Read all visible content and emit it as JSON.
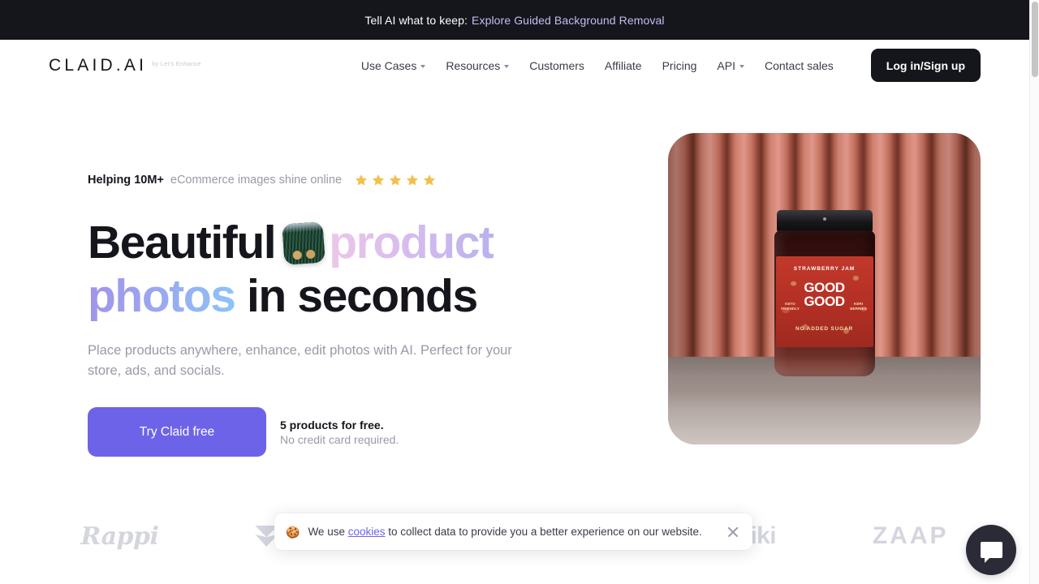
{
  "announcement": {
    "text": "Tell AI what to keep:",
    "link_label": "Explore Guided Background Removal"
  },
  "header": {
    "logo": {
      "main": "CLAID.AI",
      "sub": "by Let's Enhance"
    },
    "nav": [
      {
        "label": "Use Cases",
        "caret": true
      },
      {
        "label": "Resources",
        "caret": true
      },
      {
        "label": "Customers",
        "caret": false
      },
      {
        "label": "Affiliate",
        "caret": false
      },
      {
        "label": "Pricing",
        "caret": false
      },
      {
        "label": "API",
        "caret": true
      },
      {
        "label": "Contact sales",
        "caret": false
      }
    ],
    "login_label": "Log in/Sign up"
  },
  "hero": {
    "eyebrow_strong": "Helping 10M+",
    "eyebrow_light": "eCommerce images shine online",
    "star_count": 5,
    "star_color": "#f2c14b",
    "title_line1_a": "Beautiful",
    "title_line1_b": "product",
    "title_line2_a": "photos",
    "title_line2_b": "in seconds",
    "subtitle": "Place products anywhere, enhance, edit photos with AI. Perfect for your store, ads, and socials.",
    "cta_label": "Try Claid free",
    "cta_note_strong": "5 products for free.",
    "cta_note_light": "No credit card required.",
    "image": {
      "label_arc": "STRAWBERRY JAM",
      "label_brand_line1": "GOOD",
      "label_brand_line2": "GOOD",
      "label_bottom": "NO ADDED SUGAR",
      "label_side_left": "KETO FRIENDLY",
      "label_side_right": "KERI BERRIES"
    }
  },
  "partners": [
    {
      "name": "Rappi",
      "label": "Rappi"
    },
    {
      "name": "vistaprint",
      "label": "vistaprint"
    },
    {
      "name": "brand-3",
      "label": ""
    },
    {
      "name": "brand-4",
      "label": ""
    },
    {
      "name": "Printiki",
      "label": "Printiki"
    },
    {
      "name": "Zaap",
      "label": "ZAAP"
    }
  ],
  "cookie_banner": {
    "emoji": "🍪",
    "text_before": "We use ",
    "link_label": "cookies",
    "text_after": " to collect data to provide you a better experience on our website.",
    "close_label": "×"
  },
  "colors": {
    "accent_purple": "#6d63e8",
    "dark": "#15151c",
    "muted": "#9a9aa8",
    "link_lavender": "#c3bdf0"
  }
}
